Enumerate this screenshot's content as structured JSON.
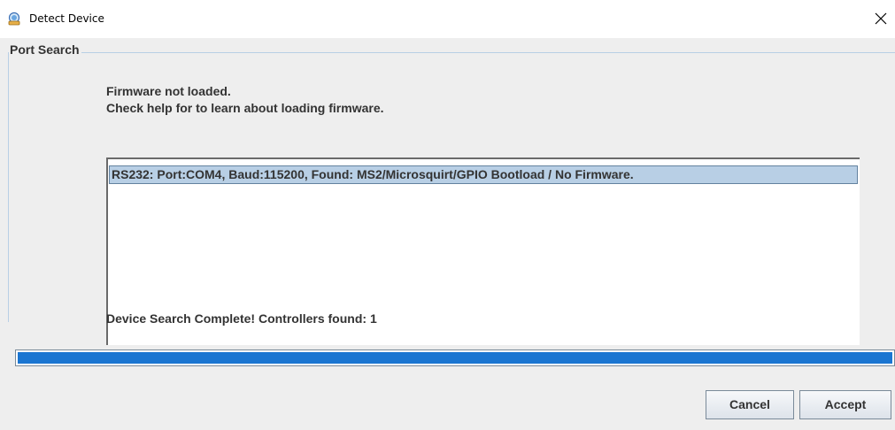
{
  "window": {
    "title": "Detect Device",
    "icon": "app-search-icon",
    "close_icon": "close-icon"
  },
  "port_search": {
    "group_title": "Port Search",
    "message_line1": "Firmware not loaded.",
    "message_line2": "Check help for to learn about loading firmware.",
    "results": [
      {
        "label": "RS232: Port:COM4, Baud:115200, Found: MS2/Microsquirt/GPIO Bootload / No Firmware.",
        "selected": true
      }
    ],
    "status": "Device Search Complete! Controllers found: 1"
  },
  "progress": {
    "percent": 100,
    "color": "#1a75d1"
  },
  "buttons": {
    "cancel": "Cancel",
    "accept": "Accept"
  },
  "colors": {
    "selection_bg": "#b8cfe5",
    "dialog_bg": "#eeeeee"
  }
}
